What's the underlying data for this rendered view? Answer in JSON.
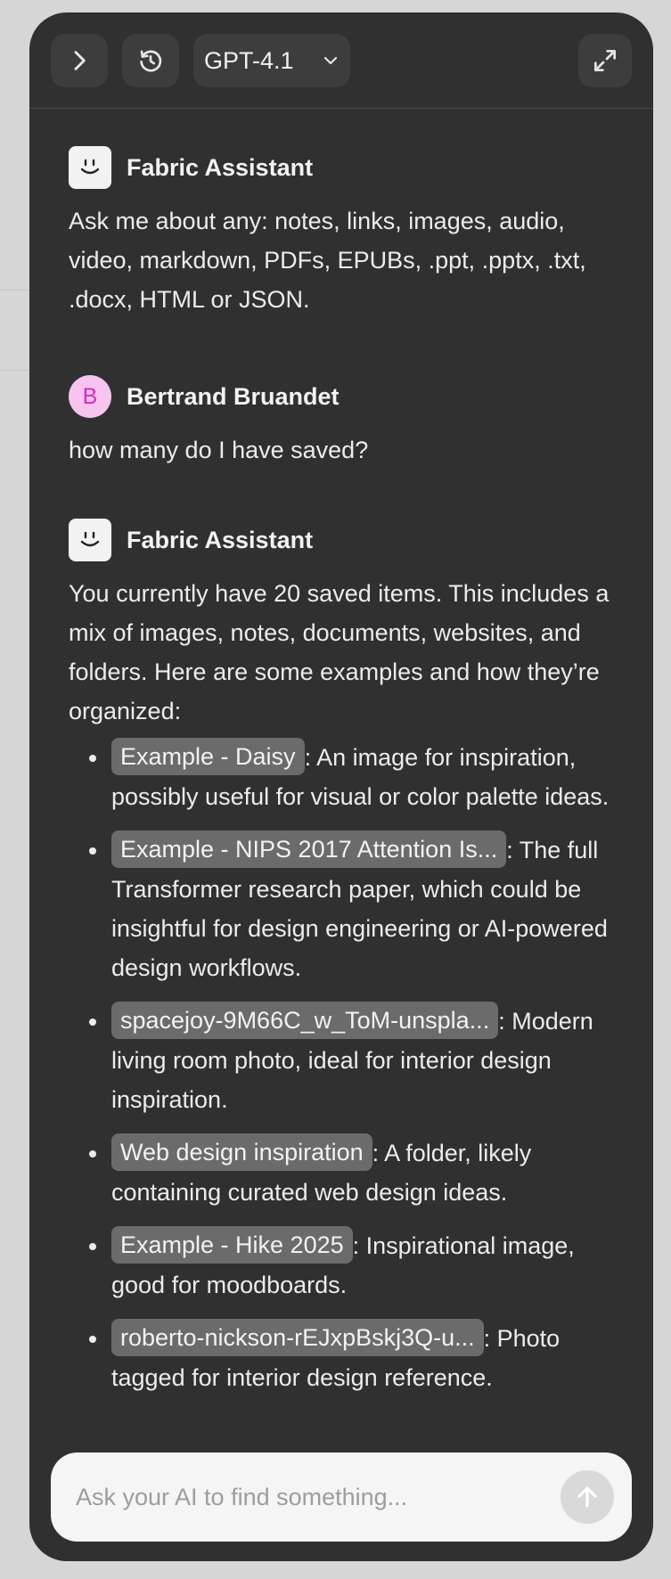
{
  "header": {
    "model_label": "GPT-4.1",
    "icons": {
      "expand": "chevron-right-icon",
      "history": "history-icon",
      "model_dropdown": "chevron-down-icon",
      "fullscreen": "fullscreen-icon"
    }
  },
  "messages": [
    {
      "sender": "Fabric Assistant",
      "avatar": "assistant-smiley-icon",
      "text": "Ask me about any: notes, links, images, audio, video, markdown, PDFs, EPUBs, .ppt, .pptx, .txt, .docx, HTML or JSON."
    },
    {
      "sender": "Bertrand Bruandet",
      "avatar_initial": "B",
      "text": "how many do I have saved?"
    },
    {
      "sender": "Fabric Assistant",
      "avatar": "assistant-smiley-icon",
      "text": "You currently have 20 saved items. This includes a mix of images, notes, documents, websites, and folders. Here are some examples and how they’re organized:",
      "items": [
        {
          "chip": "Example - Daisy",
          "desc": ": An image for inspiration, possibly useful for visual or color palette ideas."
        },
        {
          "chip": "Example - NIPS 2017 Attention Is...",
          "desc": ": The full Transformer research paper, which could be insightful for design engineering or AI-powered design workflows."
        },
        {
          "chip": "spacejoy-9M66C_w_ToM-unspla...",
          "desc": ": Modern living room photo, ideal for interior design inspiration."
        },
        {
          "chip": "Web design inspiration",
          "desc": ": A folder, likely containing curated web design ideas."
        },
        {
          "chip": "Example - Hike 2025",
          "desc": ": Inspirational image, good for moodboards."
        },
        {
          "chip": "roberto-nickson-rEJxpBskj3Q-u...",
          "desc": ": Photo tagged for interior design reference."
        }
      ]
    }
  ],
  "composer": {
    "placeholder": "Ask your AI to find something...",
    "send_icon": "arrow-up-icon"
  },
  "colors": {
    "panel_bg": "#303030",
    "page_bg": "#d6d6d6",
    "chip_bg": "#6b6b6b",
    "user_avatar_bg": "#f7c4ef",
    "user_avatar_fg": "#d629c2"
  }
}
